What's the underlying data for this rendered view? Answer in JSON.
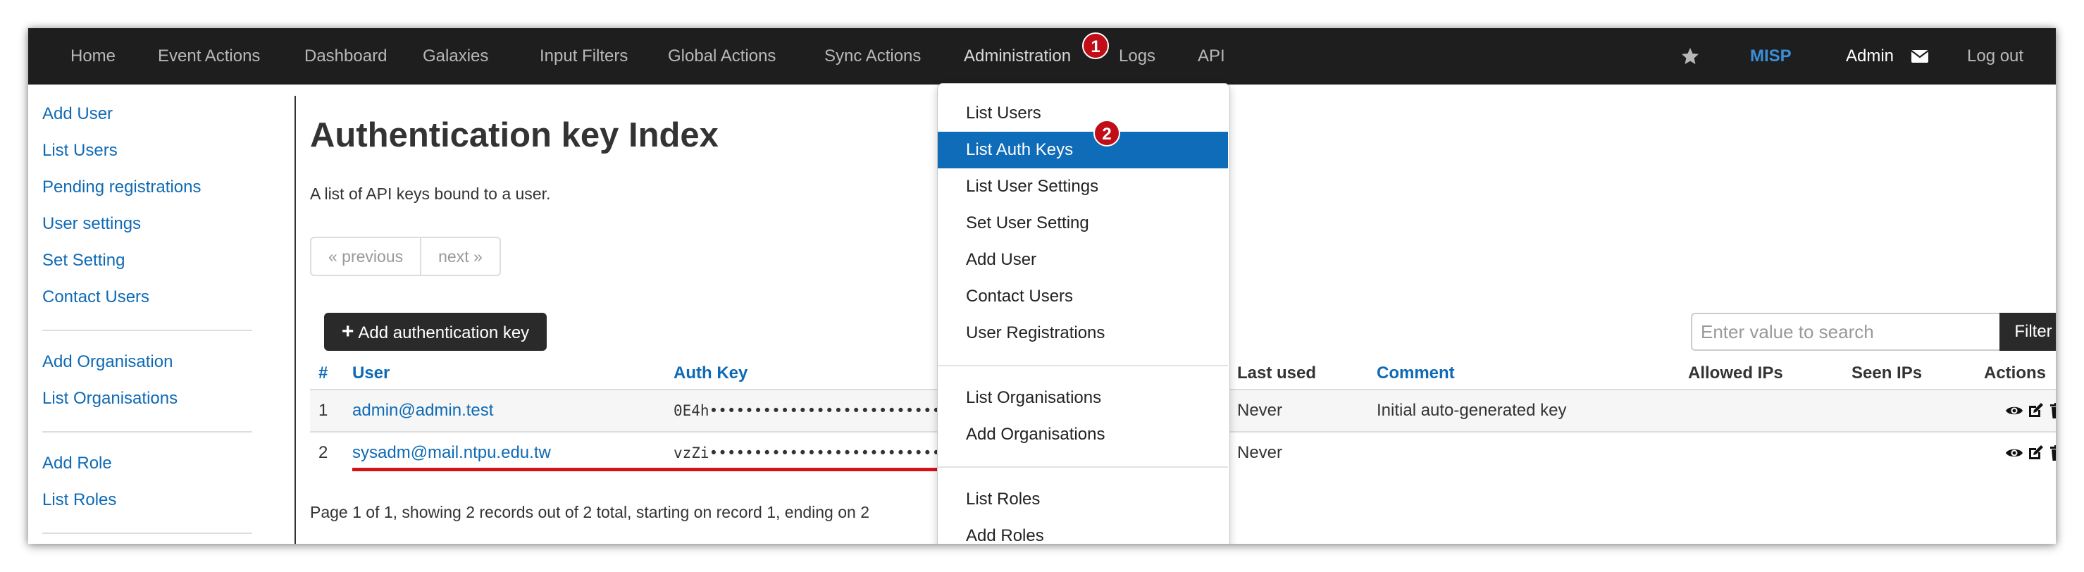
{
  "navbar": {
    "items": [
      "Home",
      "Event Actions",
      "Dashboard",
      "Galaxies",
      "Input Filters",
      "Global Actions",
      "Sync Actions",
      "Administration",
      "Logs",
      "API"
    ],
    "brand": "MISP",
    "user": "Admin",
    "logout": "Log out",
    "badge_1": "1"
  },
  "sidebar": {
    "group1": [
      "Add User",
      "List Users",
      "Pending registrations",
      "User settings",
      "Set Setting",
      "Contact Users"
    ],
    "group2": [
      "Add Organisation",
      "List Organisations"
    ],
    "group3": [
      "Add Role",
      "List Roles"
    ]
  },
  "main": {
    "title": "Authentication key Index",
    "description": "A list of API keys bound to a user.",
    "pager": {
      "previous": "« previous",
      "next": "next »"
    },
    "add_button": "Add authentication key",
    "search_placeholder": "Enter value to search",
    "filter_button": "Filter",
    "columns": [
      "#",
      "User",
      "Auth Key",
      "Last used",
      "Comment",
      "Allowed IPs",
      "Seen IPs",
      "Actions"
    ],
    "rows": [
      {
        "id": "1",
        "user": "admin@admin.test",
        "auth_key": "0E4h••••••••••••••••••••••••••••••SyEL",
        "last_used": "Never",
        "comment": "Initial auto-generated key"
      },
      {
        "id": "2",
        "user": "sysadm@mail.ntpu.edu.tw",
        "auth_key": "vzZi••••••••••••••••••••••••••••••qKAp",
        "last_used": "Never",
        "comment": ""
      }
    ],
    "status": "Page 1 of 1, showing 2 records out of 2 total, starting on record 1, ending on 2"
  },
  "dropdown": {
    "group1": [
      "List Users",
      "List Auth Keys",
      "List User Settings",
      "Set User Setting",
      "Add User",
      "Contact Users",
      "User Registrations"
    ],
    "group2": [
      "List Organisations",
      "Add Organisations"
    ],
    "group3": [
      "List Roles",
      "Add Roles"
    ],
    "active": "List Auth Keys",
    "badge_2": "2"
  },
  "colors": {
    "navbar_bg": "#1e1e1e",
    "link": "#0e6ab5",
    "active_item": "#0e6cb8",
    "badge": "#c00d17",
    "highlight_underline": "#d3131b"
  },
  "icons": [
    "star-icon",
    "envelope-icon",
    "plus-icon",
    "eye-icon",
    "edit-icon",
    "trash-icon"
  ]
}
